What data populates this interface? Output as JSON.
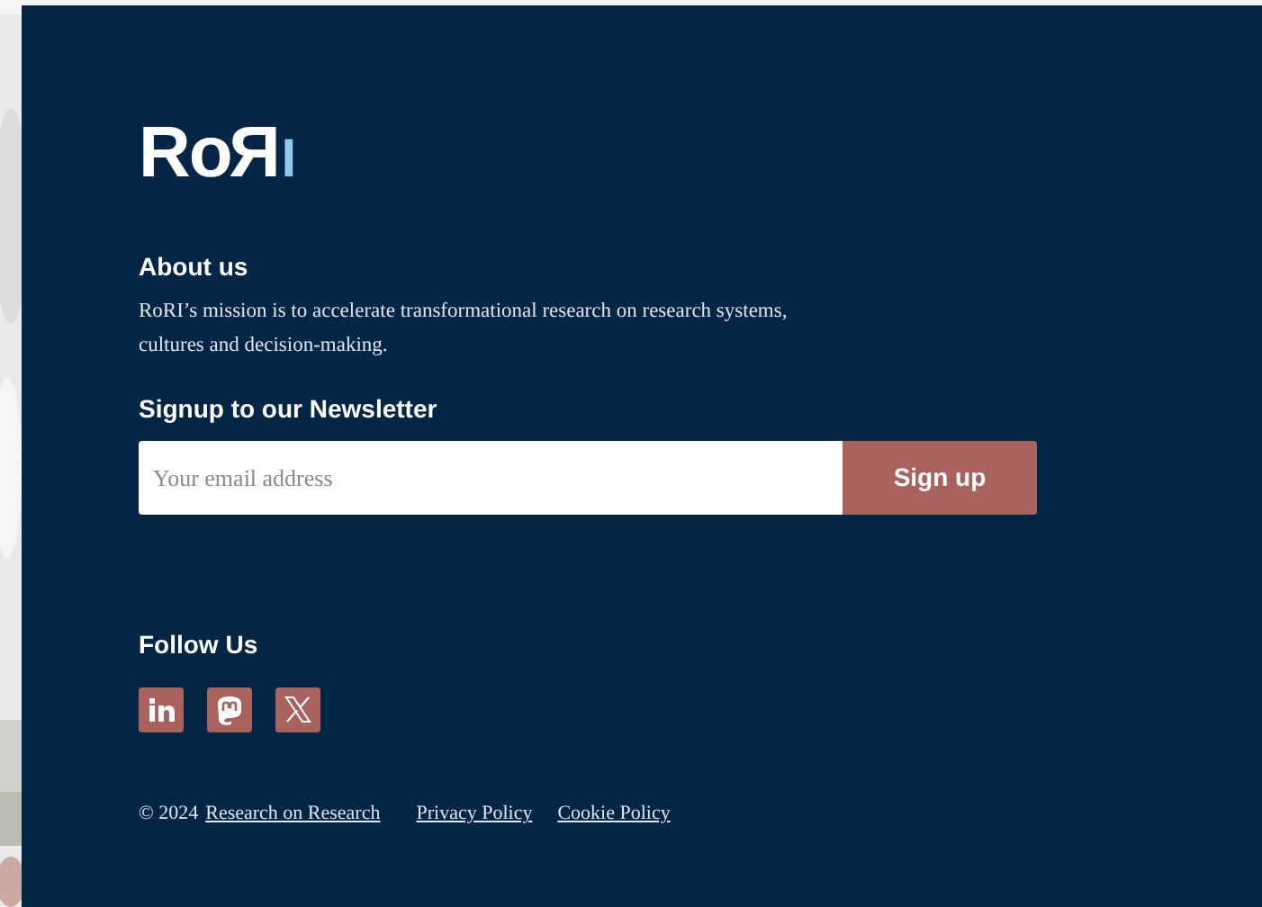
{
  "logo": {
    "text": "RoRI"
  },
  "about": {
    "heading": "About us",
    "text": "RoRI’s mission is to accelerate transformational research on research systems, cultures and decision-making."
  },
  "newsletter": {
    "heading": "Signup to our Newsletter",
    "placeholder": "Your email address",
    "button": "Sign up"
  },
  "follow": {
    "heading": "Follow Us",
    "icons": [
      {
        "kind": "linkedin"
      },
      {
        "kind": "mastodon"
      },
      {
        "kind": "x"
      }
    ]
  },
  "footer": {
    "copyright": "© 2024",
    "links": [
      "Research on Research",
      "Privacy Policy",
      "Cookie Policy"
    ]
  }
}
